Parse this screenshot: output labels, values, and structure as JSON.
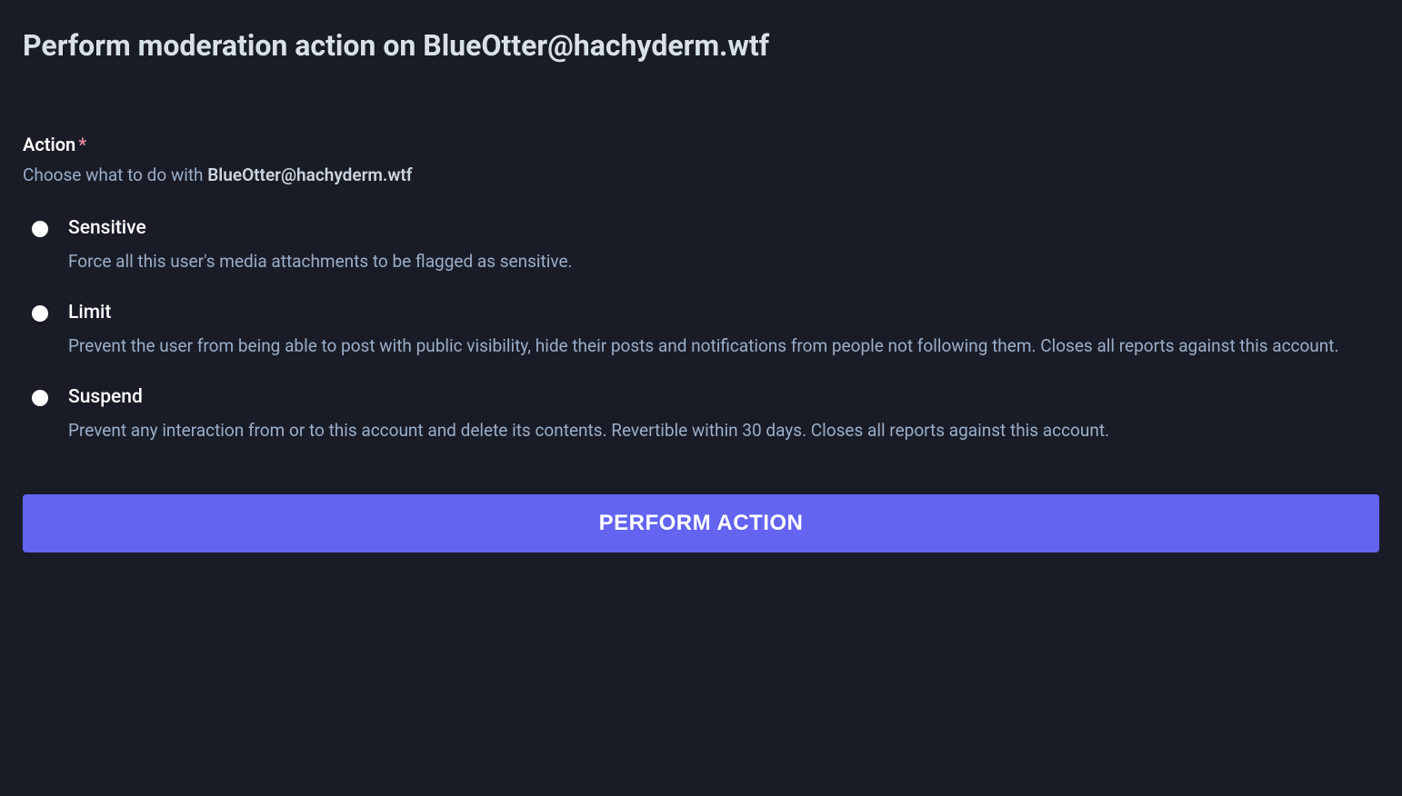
{
  "page": {
    "title": "Perform moderation action on BlueOtter@hachyderm.wtf"
  },
  "form": {
    "action_label": "Action",
    "required_mark": "*",
    "hint_prefix": "Choose what to do with ",
    "hint_target": "BlueOtter@hachyderm.wtf",
    "options": [
      {
        "label": "Sensitive",
        "description": "Force all this user's media attachments to be flagged as sensitive."
      },
      {
        "label": "Limit",
        "description": "Prevent the user from being able to post with public visibility, hide their posts and notifications from people not following them. Closes all reports against this account."
      },
      {
        "label": "Suspend",
        "description": "Prevent any interaction from or to this account and delete its contents. Revertible within 30 days. Closes all reports against this account."
      }
    ],
    "submit_label": "PERFORM ACTION"
  }
}
